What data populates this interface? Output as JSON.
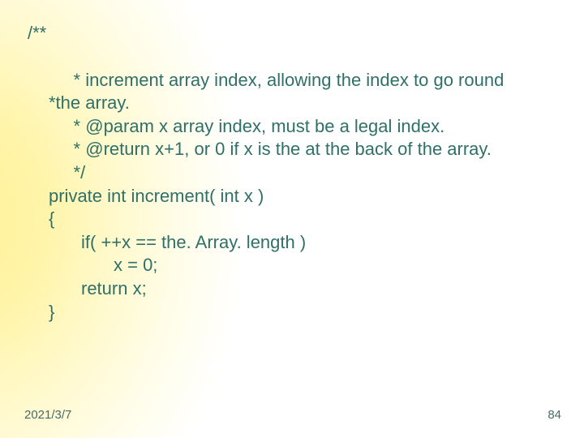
{
  "code": {
    "open_comment": "/**",
    "l1": "     * increment array index, allowing the index to go round",
    "l2": "*the array.",
    "l3": "     * @param x array index, must be a legal index.",
    "l4": "     * @return x+1, or 0 if x is the at the back of the array.",
    "l5": "     */",
    "l6": "private int increment( int x )",
    "l7": "{",
    "l8": "if( ++x == the. Array. length )",
    "l9": "x = 0;",
    "l10": "return x;",
    "l11": "}"
  },
  "footer": {
    "date": "2021/3/7",
    "page": "84"
  }
}
